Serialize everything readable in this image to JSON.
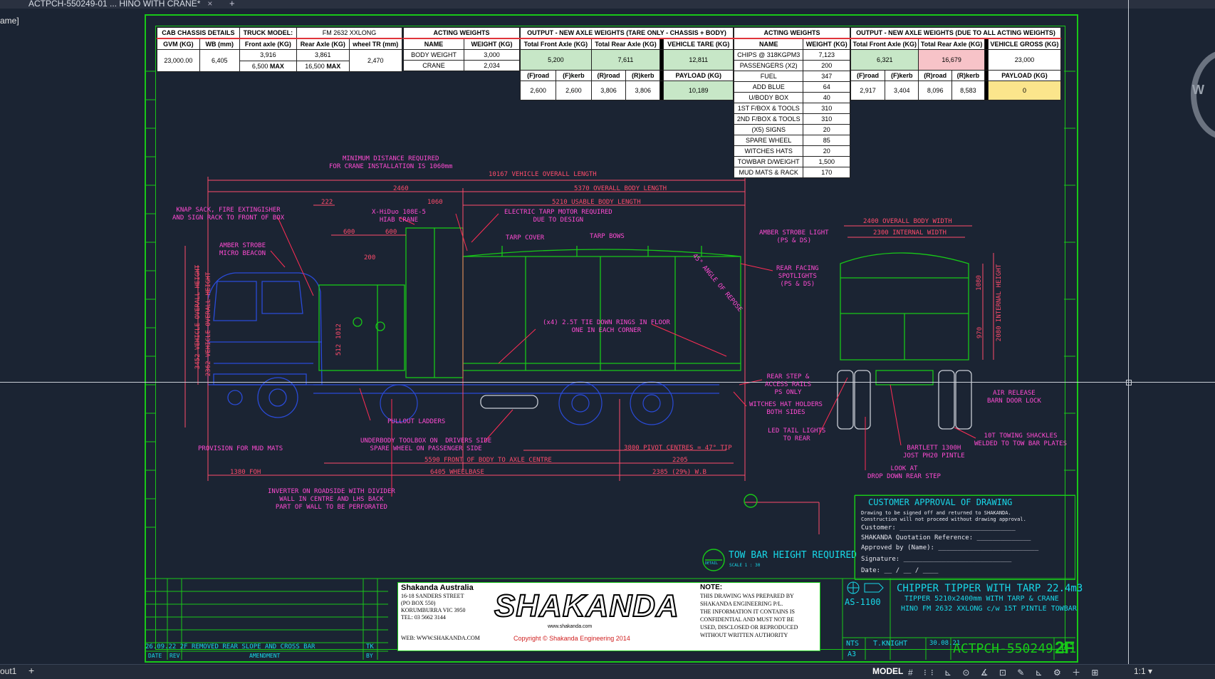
{
  "window": {
    "tab_title": "ACTPCH-550249-01 ... HINO WITH CRANE*",
    "tab_close": "×",
    "tab_add": "+",
    "side_label": "ame]"
  },
  "statusbar": {
    "layout_tab": "out1",
    "add": "+",
    "model": "MODEL",
    "scale": "1:1 ▾",
    "icons": "# ⁝⁝ ⊾ ⊙ ∡ ⊡ ✎ ⊾ ⚙ ＋ ⊞"
  },
  "nav_wheel_label": "W",
  "cab": {
    "header": [
      "CAB CHASSIS DETAILS",
      "TRUCK MODEL:",
      "FM 2632 XXLONG"
    ],
    "cols": [
      "GVM (KG)",
      "WB (mm)",
      "Front axle (KG)",
      "Rear Axle (KG)",
      "wheel TR (mm)"
    ],
    "gvm": "23,000.00",
    "wb": "6,405",
    "front": "3,916",
    "rear": "3,861",
    "front_max": "6,500",
    "rear_max": "16,500",
    "max": "MAX",
    "wheel_tr": "2,470"
  },
  "acting1": {
    "header": "ACTING WEIGHTS",
    "cols": [
      "NAME",
      "WEIGHT (KG)"
    ],
    "rows": [
      [
        "BODY WEIGHT",
        "3,000"
      ],
      [
        "CRANE",
        "2,034"
      ]
    ]
  },
  "tare": {
    "header": "OUTPUT - NEW AXLE WEIGHTS (TARE ONLY - CHASSIS + BODY)",
    "cols": [
      "Total Front Axle (KG)",
      "Total Rear Axle (KG)",
      "VEHICLE TARE (KG)"
    ],
    "front": "5,200",
    "rear": "7,611",
    "tare": "12,811",
    "sub": [
      "(F)road",
      "(F)kerb",
      "(R)road",
      "(R)kerb"
    ],
    "subv": [
      "2,600",
      "2,600",
      "3,806",
      "3,806"
    ],
    "payload_label": "PAYLOAD (KG)",
    "payload": "10,189"
  },
  "acting2": {
    "header": "ACTING WEIGHTS",
    "cols": [
      "NAME",
      "WEIGHT (KG)"
    ],
    "rows": [
      [
        "CHIPS @ 318KGPM3",
        "7,123"
      ],
      [
        "PASSENGERS (X2)",
        "200"
      ],
      [
        "FUEL",
        "347"
      ],
      [
        "ADD BLUE",
        "64"
      ],
      [
        "U/BODY BOX",
        "40"
      ],
      [
        "1ST F/BOX & TOOLS",
        "310"
      ],
      [
        "2ND F/BOX & TOOLS",
        "310"
      ],
      [
        "(X5) SIGNS",
        "20"
      ],
      [
        "SPARE WHEEL",
        "85"
      ],
      [
        "WITCHES HATS",
        "20"
      ],
      [
        "TOWBAR D/WEIGHT",
        "1,500"
      ],
      [
        "MUD MATS & RACK",
        "170"
      ]
    ]
  },
  "gross": {
    "header": "OUTPUT - NEW AXLE WEIGHTS (DUE TO ALL ACTING WEIGHTS)",
    "cols": [
      "Total Front Axle (KG)",
      "Total Rear Axle (KG)",
      "VEHICLE GROSS (KG)"
    ],
    "front": "6,321",
    "rear": "16,679",
    "gross": "23,000",
    "sub": [
      "(F)road",
      "(F)kerb",
      "(R)road",
      "(R)kerb"
    ],
    "subv": [
      "2,917",
      "3,404",
      "8,096",
      "8,583"
    ],
    "payload_label": "PAYLOAD (KG)",
    "payload": "0"
  },
  "dims": {
    "overall": "10167 VEHICLE OVERALL LENGTH",
    "d2460": "2460",
    "body": "5370 OVERALL BODY LENGTH",
    "d1060": "1060",
    "usable": "5210 USABLE BODY LENGTH",
    "d222": "222",
    "d600a": "600",
    "d600b": "600",
    "d200": "200",
    "front_axle": "5590 FRONT OF BODY TO AXLE CENTRE",
    "pivot": "3800 PIVOT CENTRES = 47° TIP",
    "d2205": "2205",
    "wb": "6405 WHEELBASE",
    "wbr": "2385 (29%) W.B",
    "foh": "1380 FOH",
    "h3452": "3452 VEHICLE OVERALL HEIGHT",
    "h2362": "2362 VEHICLE OVERALL HEIGHT",
    "h1012": "1012",
    "h512": "512",
    "width": "2400 OVERALL BODY WIDTH",
    "iwidth": "2300 INTERNAL WIDTH",
    "h1080": "1080",
    "h970": "970",
    "ih": "2080 INTERNAL HEIGHT"
  },
  "notes": {
    "min_dist": "MINIMUM DISTANCE REQUIRED\nFOR CRANE INSTALLATION IS 1060mm",
    "knap": "KNAP SACK, FIRE EXTINGISHER\nAND SIGN RACK TO FRONT OF BOX",
    "amber": "AMBER STROBE\nMICRO BEACON",
    "crane": "X-HiDuo 108E-5\nHIAB CRANE",
    "tarp_motor": "ELECTRIC TARP MOTOR REQUIRED\nDUE TO DESIGN",
    "tarp_cover": "TARP COVER",
    "tarp_bows": "TARP BOWS",
    "angle": "45° ANGLE OF REPOSE",
    "tie": "(x4) 2.5T TIE DOWN RINGS IN FLOOR\nONE IN EACH CORNER",
    "amber2": "AMBER STROBE LIGHT\n(PS & DS)",
    "spot": "REAR FACING\nSPOTLIGHTS\n(PS & DS)",
    "step": "REAR STEP &\nACCESS RAILS\nPS ONLY",
    "witch": "WITCHES HAT HOLDERS\nBOTH SIDES",
    "led": "LED TAIL LIGHTS\nTO REAR",
    "ladders": "PULLOUT LADDERS",
    "mud": "PROVISION FOR MUD MATS",
    "ubox": "UNDERBODY TOOLBOX ON  DRIVERS SIDE\nSPARE WHEEL ON PASSENGER SIDE",
    "inverter": "INVERTER ON ROADSIDE WITH DIVIDER\nWALL IN CENTRE AND LHS BACK\nPART OF WALL TO BE PERFORATED",
    "air": "AIR RELEASE\nBARN DOOR LOCK",
    "shackles": "10T TOWING SHACKLES\nWELDED TO TOW BAR PLATES",
    "bartlett": "BARTLETT 1300H\nJOST PH20 PINTLE",
    "look": "LOOK AT\nDROP DOWN REAR STEP",
    "towbar": "TOW BAR HEIGHT REQUIRED",
    "detail": "DETAIL",
    "tscale": "SCALE 1 : 30"
  },
  "approval": {
    "title": "CUSTOMER APPROVAL OF DRAWING",
    "line1": "Drawing to be signed off and returned to SHAKANDA.",
    "line2": "Construction will not proceed without drawing approval.",
    "customer": "Customer: ______________________________",
    "quote": "SHAKANDA Quotation Reference: ______________",
    "approved": "Approved by (Name): __________________________",
    "signature": "Signature: ____________________________",
    "date": "Date: __ / __ / ____"
  },
  "revision": {
    "text": "26.09.22 2F REMOVED REAR SLOPE AND CROSS BAR",
    "initials": "TK",
    "h_date": "DATE",
    "h_rev": "REV",
    "h_amend": "AMENDMENT",
    "h_by": "BY"
  },
  "company": {
    "name": "Shakanda Australia",
    "addr1": "16-18 SANDERS STREET",
    "addr2": "(PO BOX 550)",
    "addr3": "KORUMBURRA VIC 3950",
    "tel": "TEL: 03 5662 3144",
    "web": "WEB: WWW.SHAKANDA.COM",
    "logo": "SHAKANDA",
    "logo_url": "www.shakanda.com",
    "copyright": "Copyright © Shakanda Engineering 2014",
    "note_h": "NOTE:",
    "note": "THIS DRAWING WAS PREPARED BY\nSHAKANDA ENGINEERING P/L.\nTHE INFORMATION IT CONTAINS IS\nCONFIDENTIAL AND MUST NOT BE\nUSED, DISCLOSED OR REPRODUCED\nWITHOUT WRITTEN AUTHORITY"
  },
  "titleblock": {
    "code": "AS-1100",
    "title": "CHIPPER TIPPER WITH TARP 22.4m3",
    "line2": "TIPPER 5210x2400mm WITH TARP & CRANE",
    "line3": "HINO FM 2632 XXLONG c/w 15T PINTLE TOWBAR",
    "scale": "NTS",
    "size": "A3",
    "drawn": "T.KNIGHT",
    "date": "30.08.21",
    "drawing_no": "ACTPCH-550249-01",
    "rev": "2F"
  },
  "colors": {
    "bg": "#1b2433",
    "border": "#18c818",
    "dim": "#ff4b6b",
    "note": "#ff4bd3",
    "cab": "#2a4bd8",
    "body": "#18c818",
    "cyan": "#18d8e8"
  }
}
